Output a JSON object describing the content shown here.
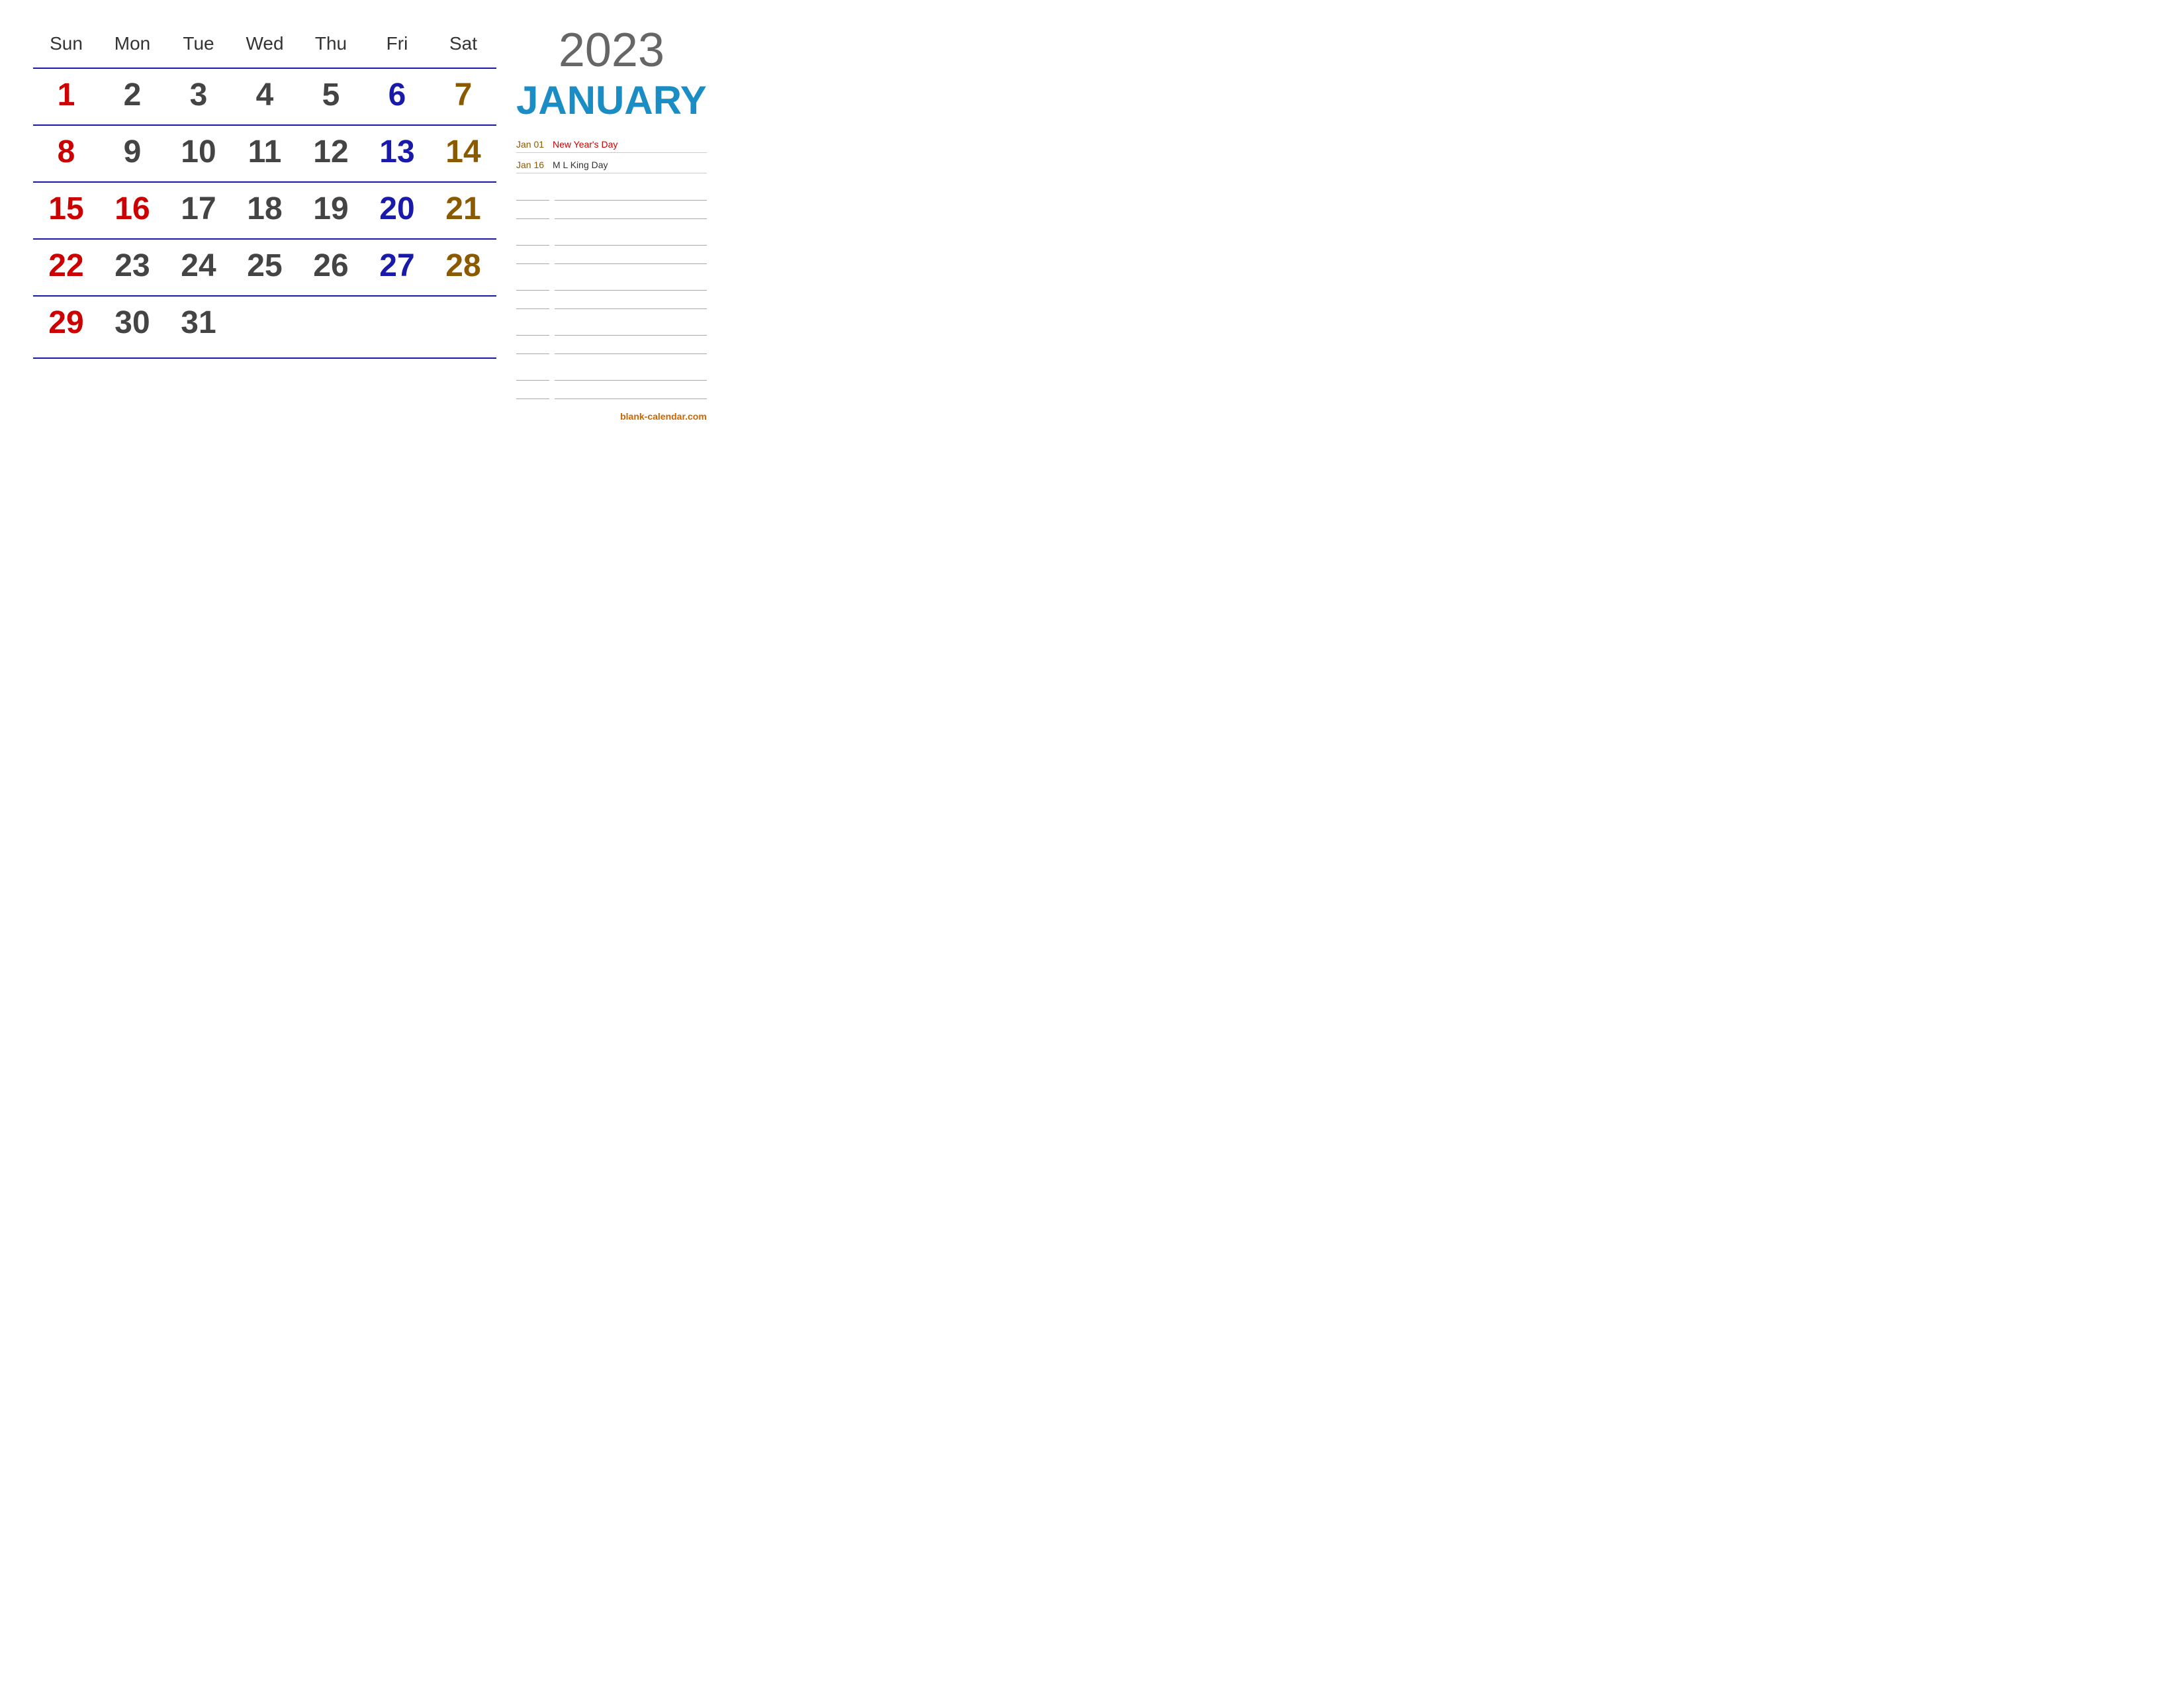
{
  "calendar": {
    "year": "2023",
    "month": "JANUARY",
    "dayHeaders": [
      "Sun",
      "Mon",
      "Tue",
      "Wed",
      "Thu",
      "Fri",
      "Sat"
    ],
    "weeks": [
      [
        {
          "day": "1",
          "type": "sunday"
        },
        {
          "day": "2",
          "type": "monday"
        },
        {
          "day": "3",
          "type": "tuesday"
        },
        {
          "day": "4",
          "type": "wednesday"
        },
        {
          "day": "5",
          "type": "thursday"
        },
        {
          "day": "6",
          "type": "friday"
        },
        {
          "day": "7",
          "type": "saturday"
        }
      ],
      [
        {
          "day": "8",
          "type": "sunday"
        },
        {
          "day": "9",
          "type": "monday"
        },
        {
          "day": "10",
          "type": "tuesday"
        },
        {
          "day": "11",
          "type": "wednesday"
        },
        {
          "day": "12",
          "type": "thursday"
        },
        {
          "day": "13",
          "type": "friday"
        },
        {
          "day": "14",
          "type": "saturday"
        }
      ],
      [
        {
          "day": "15",
          "type": "sunday"
        },
        {
          "day": "16",
          "type": "sunday"
        },
        {
          "day": "17",
          "type": "tuesday"
        },
        {
          "day": "18",
          "type": "wednesday"
        },
        {
          "day": "19",
          "type": "thursday"
        },
        {
          "day": "20",
          "type": "friday"
        },
        {
          "day": "21",
          "type": "saturday"
        }
      ],
      [
        {
          "day": "22",
          "type": "sunday"
        },
        {
          "day": "23",
          "type": "monday"
        },
        {
          "day": "24",
          "type": "tuesday"
        },
        {
          "day": "25",
          "type": "wednesday"
        },
        {
          "day": "26",
          "type": "thursday"
        },
        {
          "day": "27",
          "type": "friday"
        },
        {
          "day": "28",
          "type": "saturday"
        }
      ],
      [
        {
          "day": "29",
          "type": "sunday"
        },
        {
          "day": "30",
          "type": "monday"
        },
        {
          "day": "31",
          "type": "tuesday"
        },
        {
          "day": "",
          "type": "empty"
        },
        {
          "day": "",
          "type": "empty"
        },
        {
          "day": "",
          "type": "empty"
        },
        {
          "day": "",
          "type": "empty"
        }
      ]
    ],
    "holidays": [
      {
        "date": "Jan 01",
        "name": "New Year's Day"
      },
      {
        "date": "Jan 16",
        "name": "M L King Day"
      }
    ],
    "watermark": "blank-calendar.com"
  }
}
